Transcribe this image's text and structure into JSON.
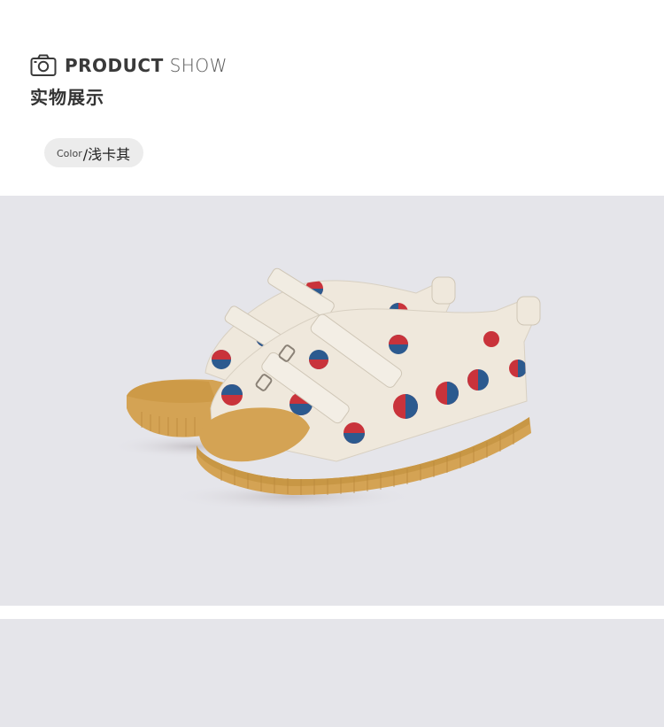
{
  "header": {
    "title_bold": "PRODUCT",
    "title_light": "SHOW",
    "subtitle_cn": "实物展示",
    "color_label": "Color",
    "color_value": "/浅卡其",
    "icon": "camera-icon"
  },
  "colors": {
    "photo_bg": "#e5e5ea",
    "sole": "#d4a354",
    "canvas": "#efe8dc",
    "dot_red": "#c9333b",
    "dot_blue": "#2c5a8f"
  }
}
